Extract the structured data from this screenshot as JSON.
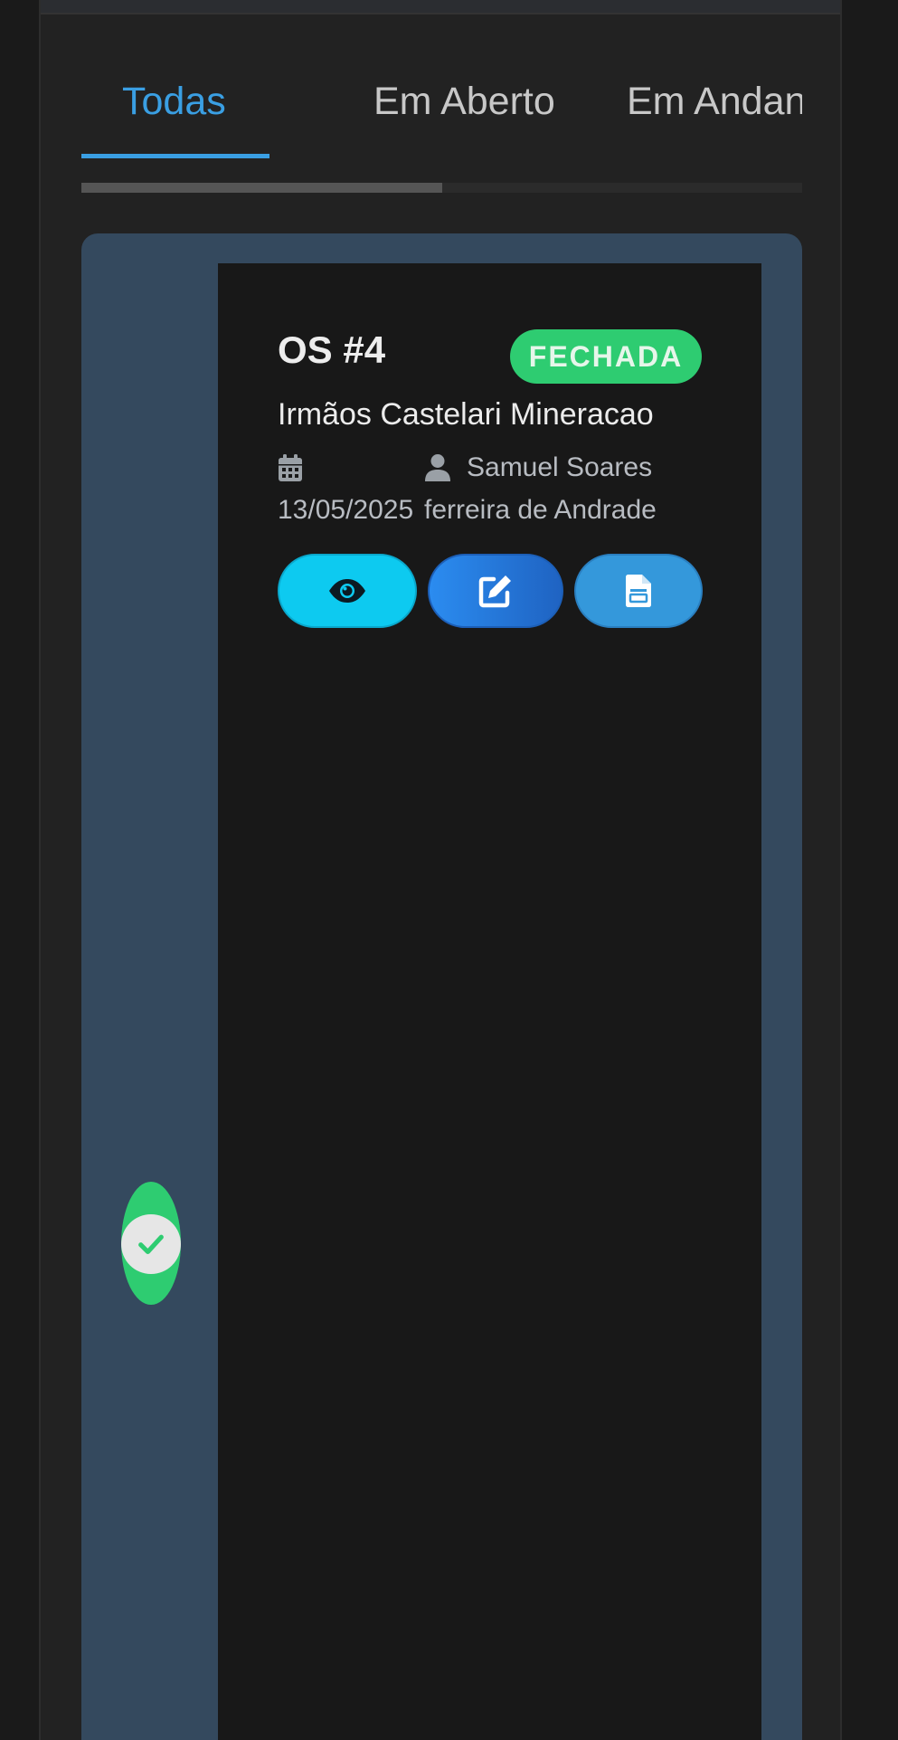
{
  "tabs": [
    {
      "label": "Todas",
      "active": true
    },
    {
      "label": "Em Aberto",
      "active": false
    },
    {
      "label": "Em Andan",
      "active": false
    }
  ],
  "scroll": {
    "position_fraction": 0.5
  },
  "order": {
    "title": "OS #4",
    "status": "FECHADA",
    "client": "Irmãos Castelari Mineracao",
    "date": "13/05/2025",
    "technician_line1": "Samuel Soares",
    "technician_line2": "ferreira de Andrade",
    "status_indicator": "check-icon"
  },
  "actions": [
    {
      "icon": "eye-icon",
      "name": "view"
    },
    {
      "icon": "edit-icon",
      "name": "edit"
    },
    {
      "icon": "document-icon",
      "name": "report"
    }
  ],
  "colors": {
    "accent": "#3a9fe3",
    "success": "#2ecc71",
    "card_background": "#34495e",
    "view_button": "#0dcaf0",
    "edit_button": "#2b8cf0",
    "report_button": "#3498db"
  }
}
